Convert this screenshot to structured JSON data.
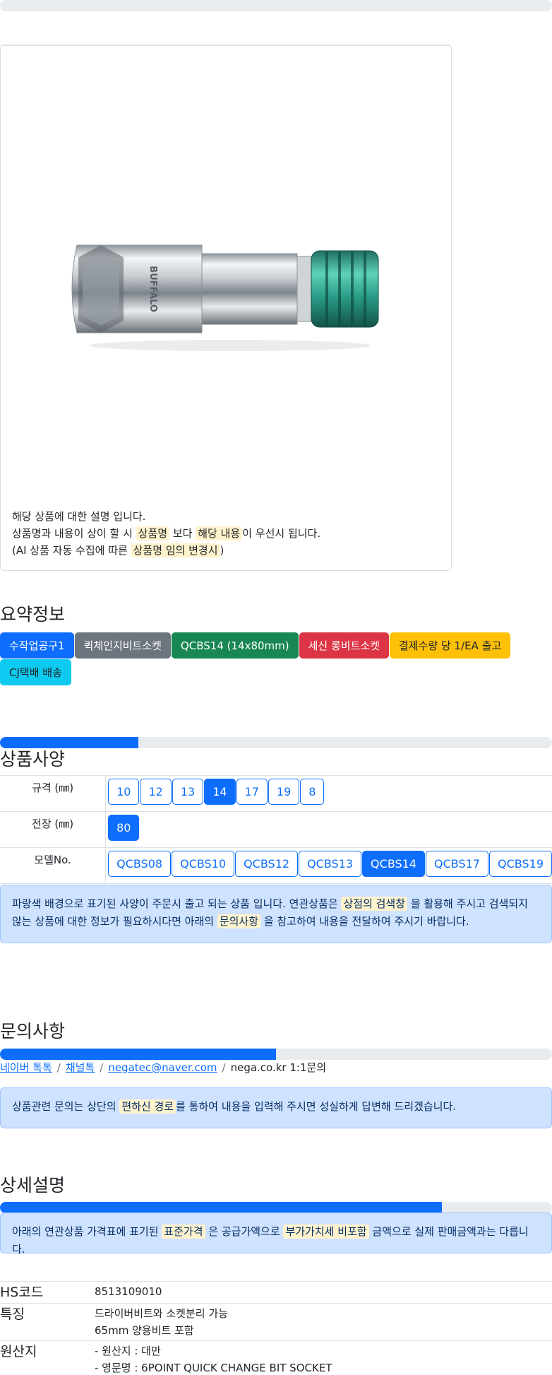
{
  "card": {
    "image_text": "BUFFALO",
    "desc_line1": "해당 상품에 대한 설명 입니다.",
    "desc_line2_a": "상품명과 내용이 상이 할 시",
    "desc_line2_hl1": "상품명",
    "desc_line2_b": "보다",
    "desc_line2_hl2": "해당 내용",
    "desc_line2_c": "이 우선시 됩니다.",
    "desc_line3_a": "(AI 상품 자동 수집에 따른",
    "desc_line3_hl": "상품명 임의 변경시",
    "desc_line3_b": ")"
  },
  "summary": {
    "title": "요약정보",
    "badges": [
      "수작업공구1",
      "퀵체인지비트소켓",
      "QCBS14 (14x80mm)",
      "세신 롱비트소켓",
      "결제수량 당 1/EA 출고",
      "CJ택배 배송"
    ]
  },
  "spec": {
    "title": "상품사양",
    "progress": 0.25,
    "rows": [
      {
        "label": "규격 (㎜)",
        "options": [
          "10",
          "12",
          "13",
          "14",
          "17",
          "19",
          "8"
        ],
        "selected": "14"
      },
      {
        "label": "전장 (㎜)",
        "options": [
          "80"
        ],
        "selected": "80"
      },
      {
        "label": "모델No.",
        "options": [
          "QCBS08",
          "QCBS10",
          "QCBS12",
          "QCBS13",
          "QCBS14",
          "QCBS17",
          "QCBS19"
        ],
        "selected": "QCBS14"
      }
    ],
    "notice_a": "파랑색 배경으로 표기된 사양이 주문시 출고 되는 상품 입니다. 연관상품은",
    "notice_hl1": "상점의 검색창",
    "notice_b": "을 활용해 주시고 검색되지 않는 상품에 대한 정보가 필요하시다면 아래의",
    "notice_hl2": "문의사항",
    "notice_c": "을 참고하여 내용을 전달하여 주시기 바랍니다."
  },
  "inquiry": {
    "title": "문의사항",
    "progress": 0.5,
    "links": [
      "네이버 톡톡",
      "채널톡",
      "negatec@naver.com"
    ],
    "plain": "nega.co.kr 1:1문의",
    "notice_a": "상품관련 문의는 상단의",
    "notice_hl": "편하신 경로",
    "notice_b": "를 통하여 내용을 입력해 주시면 성실하게 답변해 드리겠습니다."
  },
  "detail": {
    "title": "상세설명",
    "progress": 0.8,
    "notice_a": "아래의 연관상품 가격표에 표기된",
    "notice_hl1": "표준가격",
    "notice_b": "은 공급가액으로",
    "notice_hl2": "부가가치세 비포함",
    "notice_c": "금액으로 실제 판매금액과는 다릅니다.",
    "rows": [
      {
        "key": "HS코드",
        "lines": [
          "8513109010"
        ]
      },
      {
        "key": "특징",
        "lines": [
          "드라이버비트와 소켓분리 가능",
          "65mm 양용비트 포함"
        ]
      },
      {
        "key": "원산지",
        "lines": [
          "- 원산지 : 대만",
          "- 영문명 : 6POINT QUICK CHANGE BIT SOCKET"
        ]
      }
    ]
  },
  "colors": {
    "primary": "#0d6efd",
    "secondary": "#6c757d",
    "success": "#198754",
    "danger": "#dc3545",
    "warning": "#ffc107",
    "info": "#0dcaf0",
    "highlight": "#fff3cd",
    "alert_bg": "#cfe2ff"
  }
}
